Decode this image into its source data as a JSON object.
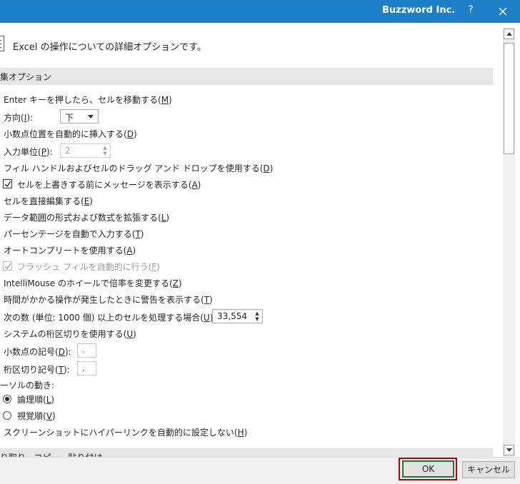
{
  "window": {
    "title": "Buzzword Inc.",
    "help_label": "?",
    "accent_color": "#1e7fc9"
  },
  "header": {
    "description": "Excel の操作についての詳細オプションです。"
  },
  "sections": {
    "edit_options": "集オプション",
    "cut_copy_paste": "り取り、コピー、貼り付け"
  },
  "options": {
    "move_after_enter": {
      "pre": "Enter キーを押したら、セルを移動する(",
      "key": "M",
      "post": ")"
    },
    "direction": {
      "pre": "方向(",
      "key": "I",
      "post": "):",
      "value": "下"
    },
    "auto_decimal": {
      "pre": "小数点位置を自動的に挿入する(",
      "key": "D",
      "post": ")"
    },
    "input_unit": {
      "pre": "入力単位(",
      "key": "P",
      "post": "):",
      "value": "2"
    },
    "fill_handle": {
      "pre": "フィル ハンドルおよびセルのドラッグ アンド ドロップを使用する(",
      "key": "D",
      "post": ")"
    },
    "alert_overwrite": {
      "pre": "セルを上書きする前にメッセージを表示する(",
      "key": "A",
      "post": ")",
      "checked": true
    },
    "edit_in_cell": {
      "pre": "セルを直接編集する(",
      "key": "E",
      "post": ")"
    },
    "extend_formats": {
      "pre": "データ範囲の形式および数式を拡張する(",
      "key": "L",
      "post": ")"
    },
    "auto_percent": {
      "pre": "パーセンテージを自動で入力する(",
      "key": "T",
      "post": ")"
    },
    "autocomplete": {
      "pre": "オートコンプリートを使用する(",
      "key": "A",
      "post": ")"
    },
    "flash_fill": {
      "pre": "フラッシュ フィルを自動的に行う(",
      "key": "F",
      "post": ")",
      "checked": true
    },
    "intellimouse_zoom": {
      "pre": "IntelliMouse のホイールで倍率を変更する(",
      "key": "Z",
      "post": ")"
    },
    "alert_slow_op": {
      "pre": "時間がかかる操作が発生したときに警告を表示する(",
      "key": "T",
      "post": ")"
    },
    "cells_threshold": {
      "pre": "次の数 (単位: 1000 個) 以上のセルを処理する場合(",
      "key": "U",
      "post": "):",
      "value": "33,554"
    },
    "use_system_separators": {
      "pre": "システムの桁区切りを使用する(",
      "key": "U",
      "post": ")"
    },
    "decimal_separator": {
      "pre": "小数点の記号(",
      "key": "D",
      "post": "):",
      "value": "."
    },
    "thousands_separator": {
      "pre": "桁区切り記号(",
      "key": "T",
      "post": "):",
      "value": ","
    },
    "cursor_movement": {
      "label": "ーソルの動き:"
    },
    "logical": {
      "pre": "論理順(",
      "key": "L",
      "post": ")",
      "selected": true
    },
    "visual": {
      "pre": "視覚順(",
      "key": "V",
      "post": ")",
      "selected": false
    },
    "no_auto_hyperlink": {
      "pre": "スクリーンショットにハイパーリンクを自動的に設定しない(",
      "key": "H",
      "post": ")"
    }
  },
  "buttons": {
    "ok": "OK",
    "cancel": "キャンセル"
  }
}
